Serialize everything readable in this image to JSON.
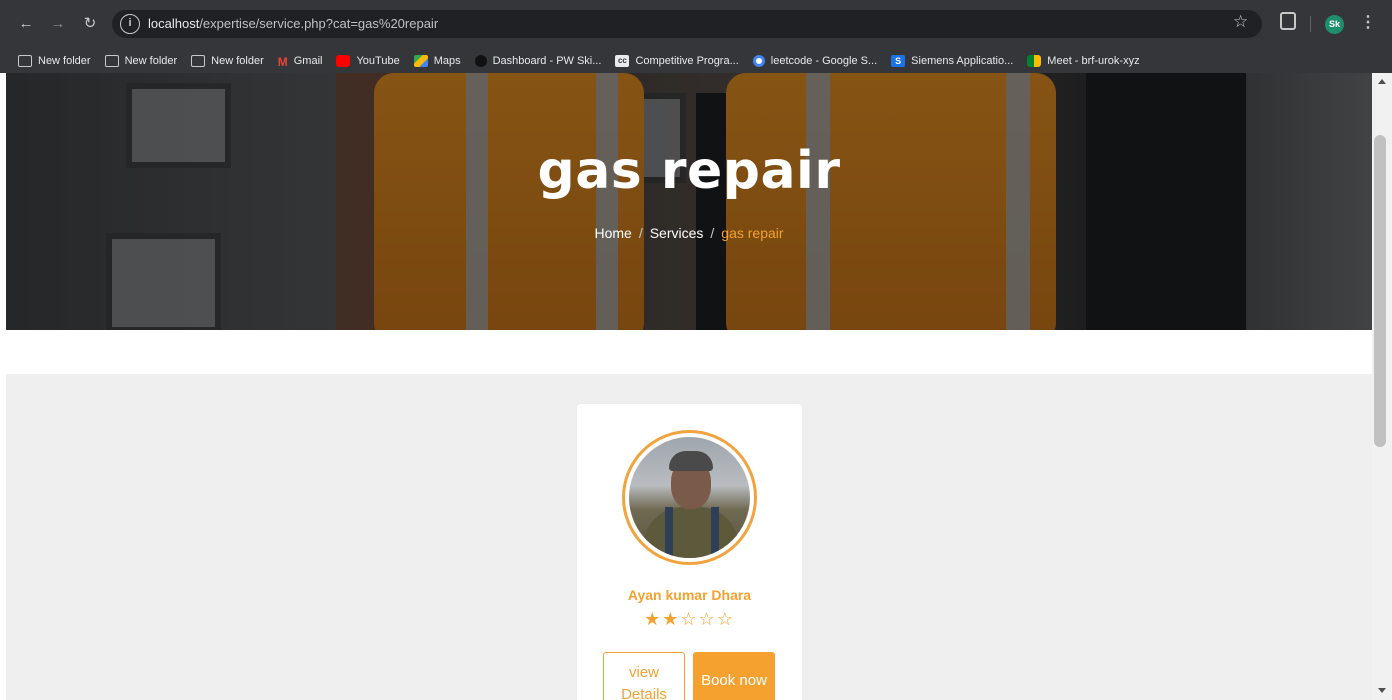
{
  "browser": {
    "url_host": "localhost",
    "url_path": "/expertise/service.php?cat=gas%20repair",
    "profile_initials": "Sk",
    "bookmarks": [
      {
        "label": "New folder",
        "icon": "folder-icon"
      },
      {
        "label": "New folder",
        "icon": "folder-icon"
      },
      {
        "label": "New folder",
        "icon": "folder-icon"
      },
      {
        "label": "Gmail",
        "icon": "gmail-icon"
      },
      {
        "label": "YouTube",
        "icon": "youtube-icon"
      },
      {
        "label": "Maps",
        "icon": "maps-icon"
      },
      {
        "label": "Dashboard - PW Ski...",
        "icon": "pw-icon"
      },
      {
        "label": "Competitive Progra...",
        "icon": "cc-icon"
      },
      {
        "label": "leetcode - Google S...",
        "icon": "google-icon"
      },
      {
        "label": "Siemens Applicatio...",
        "icon": "siemens-icon"
      },
      {
        "label": "Meet - brf-urok-xyz",
        "icon": "meet-icon"
      }
    ]
  },
  "hero": {
    "title": "gas repair",
    "breadcrumb": {
      "home": "Home",
      "separator": "/",
      "services": "Services",
      "current": "gas repair"
    }
  },
  "card": {
    "name": "Ayan kumar Dhara",
    "rating": 2,
    "rating_max": 5,
    "stars_full": "★★",
    "stars_empty": "☆☆☆",
    "view_label": "view Details",
    "book_label": "Book now"
  },
  "colors": {
    "accent": "#f5a130",
    "chrome": "#35363a",
    "content_bg": "#efefef"
  }
}
